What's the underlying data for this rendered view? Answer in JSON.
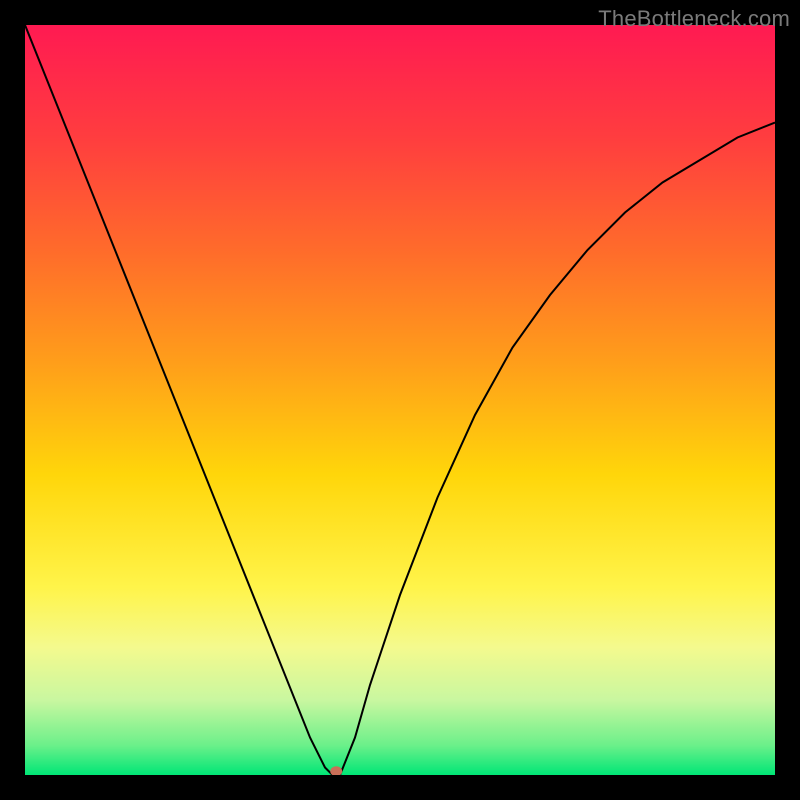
{
  "watermark": "TheBottleneck.com",
  "chart_data": {
    "type": "line",
    "title": "",
    "xlabel": "",
    "ylabel": "",
    "xlim": [
      0,
      100
    ],
    "ylim": [
      0,
      100
    ],
    "grid": false,
    "legend": false,
    "background": {
      "type": "vertical-gradient",
      "stops": [
        {
          "pos": 0.0,
          "color": "#ff1a52"
        },
        {
          "pos": 0.15,
          "color": "#ff3d3f"
        },
        {
          "pos": 0.3,
          "color": "#ff6b2b"
        },
        {
          "pos": 0.45,
          "color": "#ff9e1a"
        },
        {
          "pos": 0.6,
          "color": "#ffd60a"
        },
        {
          "pos": 0.75,
          "color": "#fff44a"
        },
        {
          "pos": 0.83,
          "color": "#f4fa8e"
        },
        {
          "pos": 0.9,
          "color": "#c9f7a0"
        },
        {
          "pos": 0.96,
          "color": "#6cf08a"
        },
        {
          "pos": 1.0,
          "color": "#00e676"
        }
      ]
    },
    "series": [
      {
        "name": "bottleneck-curve",
        "color": "#000000",
        "stroke_width": 2,
        "x": [
          0,
          4,
          8,
          12,
          16,
          20,
          24,
          28,
          32,
          36,
          38,
          40,
          41,
          42,
          44,
          46,
          50,
          55,
          60,
          65,
          70,
          75,
          80,
          85,
          90,
          95,
          100
        ],
        "y": [
          100,
          90,
          80,
          70,
          60,
          50,
          40,
          30,
          20,
          10,
          5,
          1,
          0,
          0,
          5,
          12,
          24,
          37,
          48,
          57,
          64,
          70,
          75,
          79,
          82,
          85,
          87
        ]
      }
    ],
    "markers": [
      {
        "name": "min-point",
        "x": 41.5,
        "y": 0.5,
        "color": "#c96f58",
        "rx": 6,
        "ry": 5
      }
    ]
  }
}
